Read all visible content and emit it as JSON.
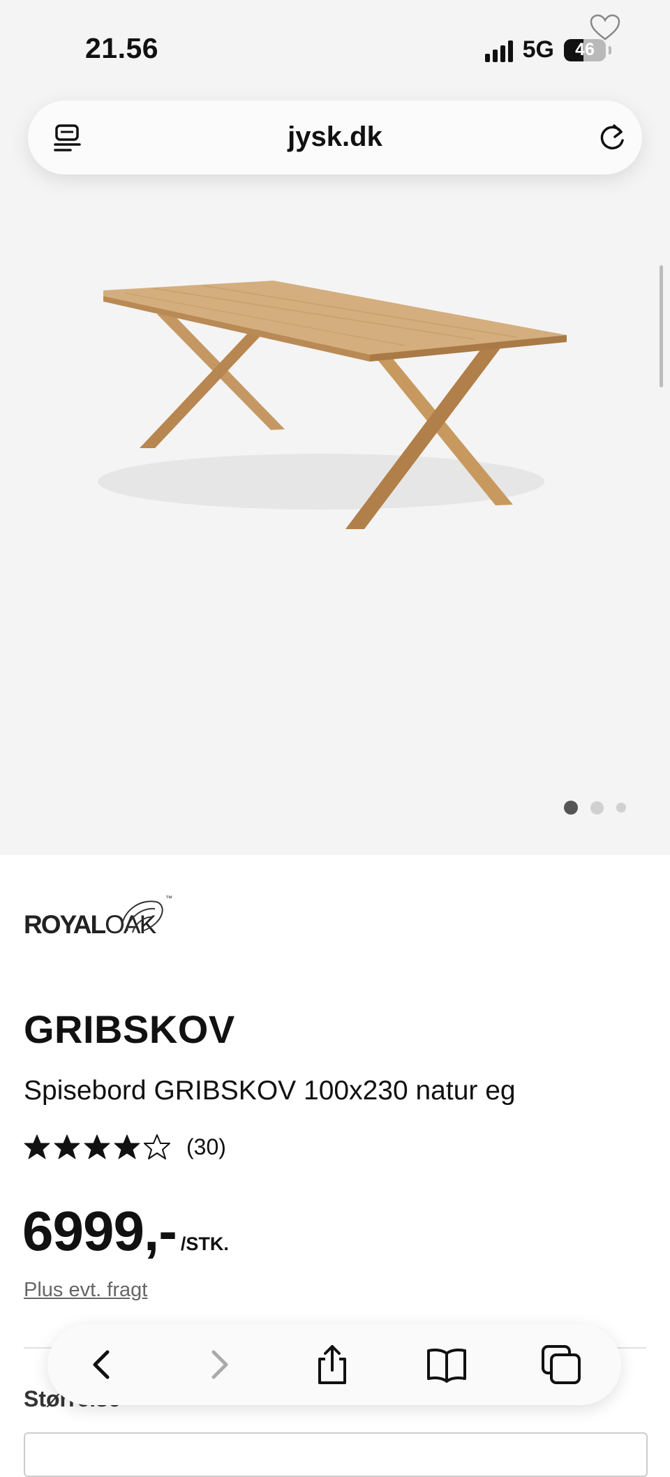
{
  "status_bar": {
    "time": "21.56",
    "network": "5G",
    "battery_text": "46",
    "battery_level": 0.46,
    "icons": [
      "signal-icon",
      "battery-icon",
      "favorite-heart-icon"
    ]
  },
  "browser": {
    "url": "jysk.dk",
    "icons": [
      "reader-mode-icon",
      "reload-icon"
    ]
  },
  "gallery": {
    "image": "dining-table-product-image",
    "page_count": 3,
    "active_index": 0
  },
  "product": {
    "brand_part1": "ROYAL",
    "brand_part2": "OAK",
    "brand_tm": "™",
    "title": "GRIBSKOV",
    "subtitle": "Spisebord GRIBSKOV 100x230 natur eg",
    "rating": 4,
    "rating_max": 5,
    "reviews": "(30)",
    "price": "6999,-",
    "unit": "/STK.",
    "shipping": "Plus evt. fragt",
    "size_label": "Størrelse"
  },
  "toolbar": {
    "icons": [
      "back-icon",
      "forward-icon",
      "share-icon",
      "bookmarks-icon",
      "tabs-icon"
    ]
  },
  "colors": {
    "hero_bg": "#f4f4f4",
    "wood_light": "#d4ae7e",
    "wood_dark": "#b98a55"
  }
}
